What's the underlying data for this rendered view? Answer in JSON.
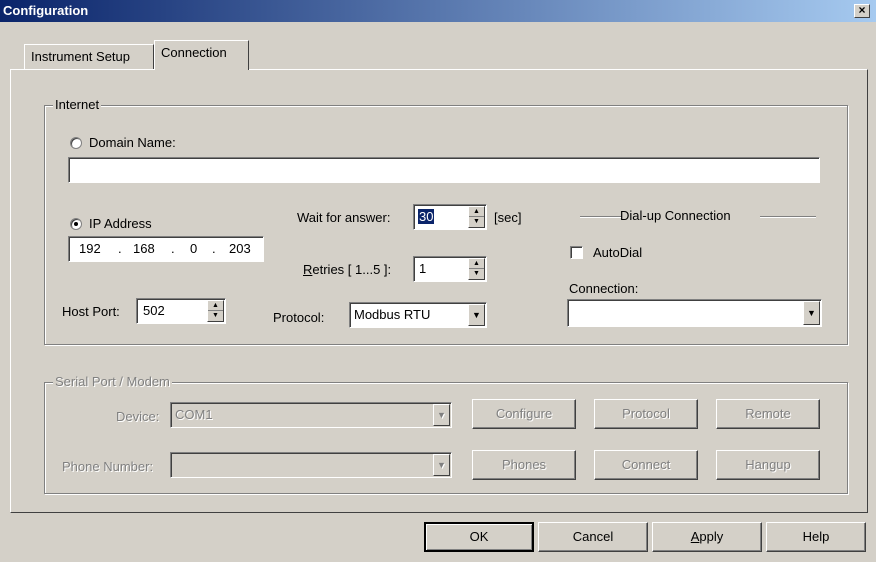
{
  "window": {
    "title": "Configuration",
    "close_glyph": "×"
  },
  "tabs": [
    {
      "label": "Instrument Setup"
    },
    {
      "label": "Connection"
    }
  ],
  "internet": {
    "legend": "Internet",
    "domain_name_label": "Domain Name:",
    "domain_name_value": "",
    "ip_address_label": "IP Address",
    "ip": {
      "a": "192",
      "b": "168",
      "c": "0",
      "d": "203",
      "dot": "."
    },
    "host_port_label": "Host Port:",
    "host_port_value": "502",
    "wait_label": "Wait for answer:",
    "wait_value": "30",
    "wait_unit": "[sec]",
    "retries_label_first": "R",
    "retries_label_rest": "etries [ 1...5 ]:",
    "retries_value": "1",
    "protocol_label": "Protocol:",
    "protocol_value": "Modbus RTU",
    "dialup_title": "Dial-up Connection",
    "autodial_label": "AutoDial",
    "connection_label": "Connection:",
    "connection_value": ""
  },
  "serial": {
    "legend": "Serial Port / Modem",
    "device_label": "Device:",
    "device_value": "COM1",
    "phone_label": "Phone Number:",
    "phone_value": "",
    "buttons": {
      "configure": "Configure",
      "protocol": "Protocol",
      "remote": "Remote",
      "phones": "Phones",
      "connect": "Connect",
      "hangup": "Hangup"
    }
  },
  "footer": {
    "ok": "OK",
    "cancel": "Cancel",
    "apply_first": "A",
    "apply_rest": "pply",
    "help": "Help"
  },
  "icons": {
    "spin_up": "▲",
    "spin_down": "▼",
    "dropdown": "▼"
  }
}
